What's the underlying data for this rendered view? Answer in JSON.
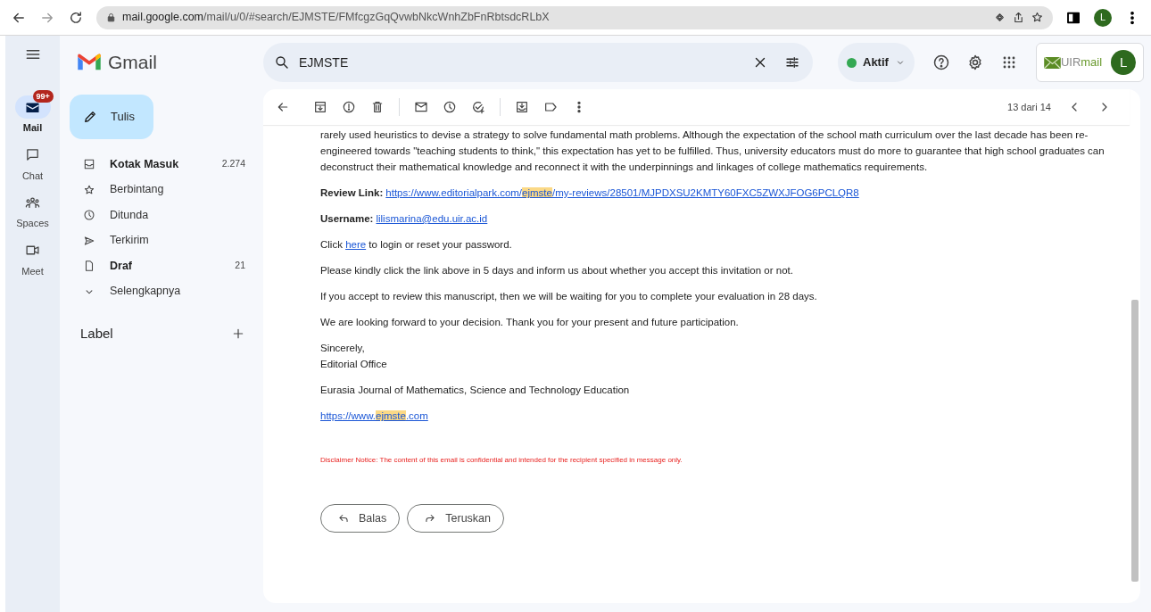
{
  "browser": {
    "url_host": "mail.google.com",
    "url_path": "/mail/u/0/#search/EJMSTE/FMfcgzGqQvwbNkcWnhZbFnRbtsdcRLbX",
    "avatar": "L"
  },
  "header": {
    "app_name": "Gmail",
    "search_value": "EJMSTE",
    "status": {
      "label": "Aktif",
      "color": "#34a853"
    },
    "org_logo": [
      "UIR",
      "mail"
    ],
    "avatar": "L"
  },
  "rail": [
    {
      "label": "Mail",
      "selected": true,
      "badge": "99+"
    },
    {
      "label": "Chat",
      "selected": false
    },
    {
      "label": "Spaces",
      "selected": false
    },
    {
      "label": "Meet",
      "selected": false
    }
  ],
  "compose": "Tulis",
  "folders": [
    {
      "label": "Kotak Masuk",
      "count": "2.274",
      "bold": true,
      "selected": false
    },
    {
      "label": "Berbintang",
      "bold": false,
      "selected": false
    },
    {
      "label": "Ditunda",
      "bold": false,
      "selected": false
    },
    {
      "label": "Terkirim",
      "bold": false,
      "selected": false
    },
    {
      "label": "Draf",
      "count": "21",
      "bold": true,
      "selected": false
    },
    {
      "label": "Selengkapnya",
      "bold": false,
      "selected": false
    }
  ],
  "labels_heading": "Label",
  "pager": "13 dari 14",
  "body": [
    {
      "kind": "paragraph",
      "text": "rarely used heuristics to devise a strategy to solve fundamental math problems. Although the expectation of the school math curriculum over the last decade has been re-engineered towards \"teaching students to think,\" this expectation has yet to be fulfilled. Thus, university educators must do more to guarantee that high school graduates can deconstruct their mathematical knowledge and reconnect it with the underpinnings and linkages of college mathematics requirements."
    },
    {
      "kind": "labeled_link",
      "label": "Review Link:",
      "link": [
        {
          "text": "https://www.editorialpark.com/",
          "highlighted": false
        },
        {
          "text": "ejmste",
          "highlighted": true
        },
        {
          "text": "/my-reviews/28501/MJPDXSU2KMTY60FXC5ZWXJFOG6PCLQR8",
          "highlighted": false
        }
      ]
    },
    {
      "kind": "labeled_link",
      "label": "Username:",
      "link": [
        {
          "text": "lilismarina@edu.uir.ac.id",
          "highlighted": false
        }
      ]
    },
    {
      "kind": "inline_link",
      "before": "Click",
      "link": "here",
      "after": "to login or reset your password."
    },
    {
      "kind": "paragraph",
      "text": "Please kindly click the link above in 5 days and inform us about whether you accept this invitation or not."
    },
    {
      "kind": "paragraph",
      "text": "If you accept to review this manuscript, then we will be waiting for you to complete your evaluation in 28 days."
    },
    {
      "kind": "paragraph",
      "text": "We are looking forward to your decision. Thank you for your present and future participation."
    },
    {
      "kind": "lines",
      "lines": [
        "Sincerely,",
        "Editorial Office"
      ]
    },
    {
      "kind": "paragraph",
      "text": "Eurasia Journal of Mathematics, Science and Technology Education"
    },
    {
      "kind": "link",
      "link": [
        {
          "text": "https://www.",
          "highlighted": false
        },
        {
          "text": "ejmste",
          "highlighted": true
        },
        {
          "text": ".com",
          "highlighted": false
        }
      ]
    },
    {
      "kind": "disclaimer",
      "text": "Disclaimer Notice: The content of this email is confidential and intended for the recipient specified in message only."
    }
  ],
  "actions": [
    {
      "label": "Balas",
      "kind": "reply"
    },
    {
      "label": "Teruskan",
      "kind": "forward"
    }
  ]
}
